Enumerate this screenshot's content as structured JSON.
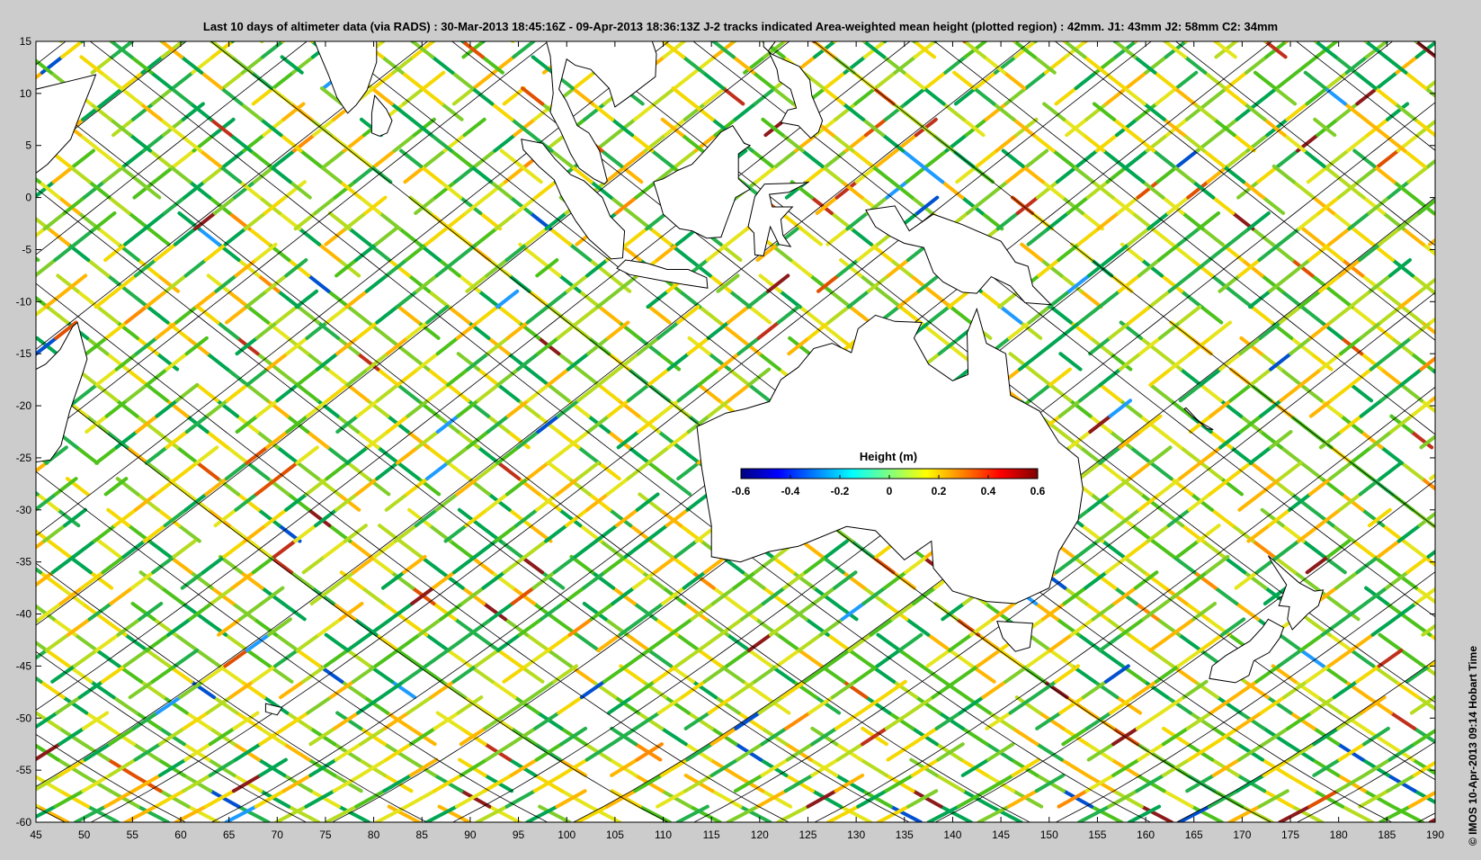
{
  "title": "Last 10 days of altimeter data (via RADS) : 30-Mar-2013 18:45:16Z - 09-Apr-2013 18:36:13Z  J-2 tracks indicated  Area-weighted mean height (plotted region) : 42mm.  J1: 43mm  J2: 58mm  C2: 34mm",
  "credit": "© IMOS 10-Apr-2013 09:14 Hobart Time",
  "map": {
    "lon_range": [
      45,
      190
    ],
    "lat_range": [
      -60,
      15
    ],
    "x_ticks": [
      "45",
      "50",
      "55",
      "60",
      "65",
      "70",
      "75",
      "80",
      "85",
      "90",
      "95",
      "100",
      "105",
      "110",
      "115",
      "120",
      "125",
      "130",
      "135",
      "140",
      "145",
      "150",
      "155",
      "160",
      "165",
      "170",
      "175",
      "180",
      "185",
      "190"
    ],
    "y_ticks": [
      "15",
      "10",
      "5",
      "0",
      "-5",
      "-10",
      "-15",
      "-20",
      "-25",
      "-30",
      "-35",
      "-40",
      "-45",
      "-50",
      "-55",
      "-60"
    ],
    "land_color": "#ffffff",
    "coast_color": "#000000",
    "track_line_color": "#000000"
  },
  "colorbar": {
    "title": "Height (m)",
    "range": [
      -0.6,
      0.6
    ],
    "ticks": [
      "-0.6",
      "-0.4",
      "-0.2",
      "0",
      "0.2",
      "0.4",
      "0.6"
    ],
    "colors": [
      "#00007f",
      "#0000ff",
      "#007fff",
      "#00ffff",
      "#7fff7f",
      "#ffff00",
      "#ff7f00",
      "#ff0000",
      "#7f0000"
    ]
  },
  "observation_colors": {
    "dominant": [
      "#00a651",
      "#22b14c",
      "#4cc21a",
      "#7fce2a",
      "#b5dc1e",
      "#e5e51c",
      "#f5d800",
      "#ffb600"
    ],
    "sparse": [
      "#ff8c00",
      "#e05000",
      "#1f9bff",
      "#0050d0",
      "#8c1a1a",
      "#c0301a"
    ]
  }
}
